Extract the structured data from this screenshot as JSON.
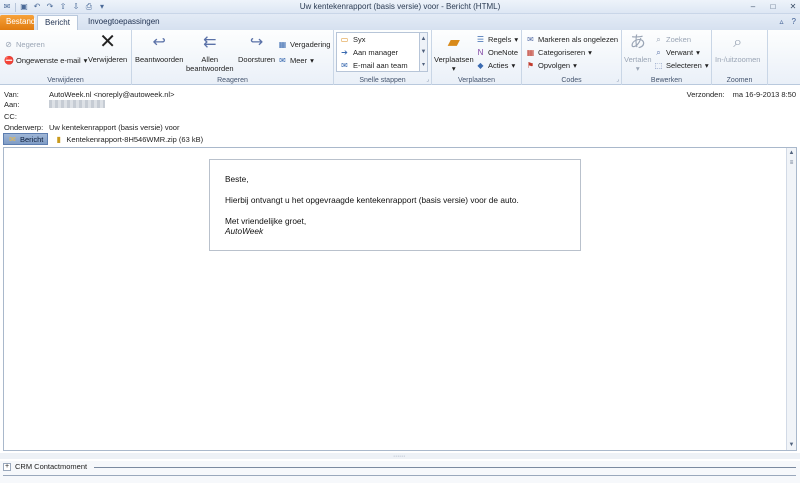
{
  "window": {
    "title": "Uw kentekenrapport (basis versie) voor  -  Bericht (HTML)"
  },
  "qat": [
    "app-icon",
    "save-icon",
    "undo-icon",
    "redo-icon",
    "up-icon",
    "down-icon",
    "print-icon",
    "customize-icon"
  ],
  "tabs": {
    "file": "Bestand",
    "active": "Bericht",
    "other": "Invoegtoepassingen"
  },
  "ribbon": {
    "verwijderen": {
      "label": "Verwijderen",
      "ignore": "Negeren",
      "junk": "Ongewenste e-mail",
      "delete": "Verwijderen"
    },
    "reageren": {
      "label": "Reageren",
      "reply": "Beantwoorden",
      "reply_all_1": "Allen",
      "reply_all_2": "beantwoorden",
      "forward": "Doorsturen",
      "meeting": "Vergadering",
      "more": "Meer"
    },
    "snelle_stappen": {
      "label": "Snelle stappen",
      "items": [
        "Syx",
        "Aan manager",
        "E-mail aan team"
      ]
    },
    "verplaatsen": {
      "label": "Verplaatsen",
      "move": "Verplaatsen",
      "rules": "Regels",
      "onenote": "OneNote",
      "actions": "Acties"
    },
    "codes": {
      "label": "Codes",
      "unread": "Markeren als ongelezen",
      "categorize": "Categoriseren",
      "followup": "Opvolgen"
    },
    "bewerken": {
      "label": "Bewerken",
      "translate": "Vertalen",
      "find": "Zoeken",
      "related": "Verwant",
      "select": "Selecteren"
    },
    "zoomen": {
      "label": "Zoomen",
      "zoom": "In-/uitzoomen"
    }
  },
  "header": {
    "from_label": "Van:",
    "from": "AutoWeek.nl <noreply@autoweek.nl>",
    "to_label": "Aan:",
    "cc_label": "CC:",
    "subject_label": "Onderwerp:",
    "subject": "Uw kentekenrapport (basis versie) voor",
    "sent_label": "Verzonden:",
    "sent": "ma 16-9-2013 8:50"
  },
  "attachments": {
    "message_tab": "Bericht",
    "file": "Kentekenrapport-8H546WMR.zip (63 kB)"
  },
  "mail": {
    "greeting": "Beste,",
    "line": "Hierbij ontvangt u het opgevraagde kentekenrapport (basis versie) voor de auto.",
    "closing": "Met vriendelijke groet,",
    "signature": "AutoWeek"
  },
  "crm": {
    "label": "CRM Contactmoment"
  }
}
